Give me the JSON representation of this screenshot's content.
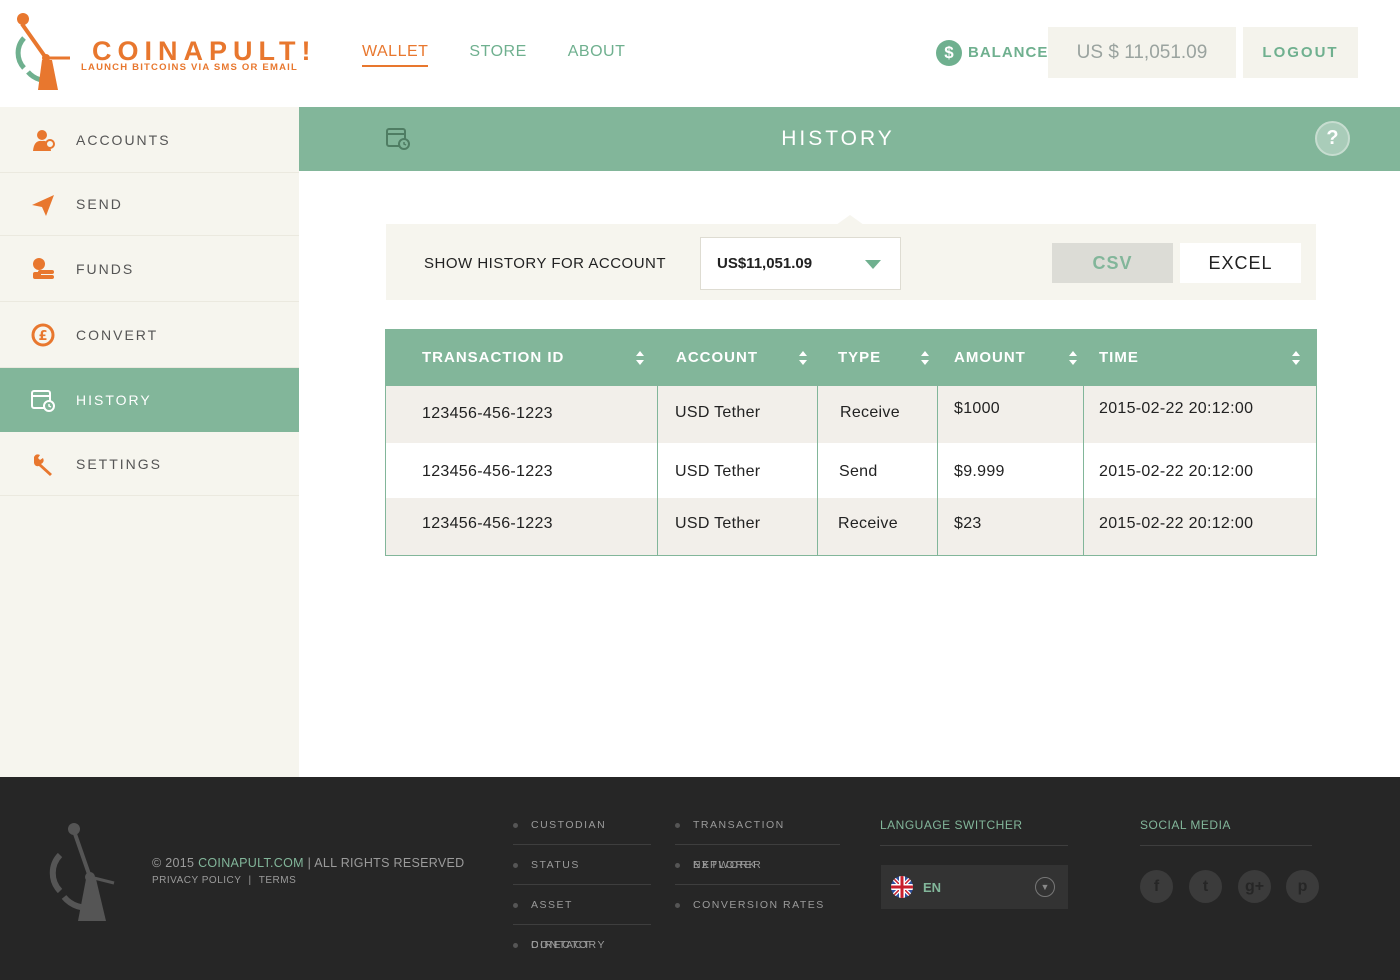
{
  "header": {
    "logo_title": "COINAPULT!",
    "logo_tagline": "LAUNCH BITCOINS VIA SMS OR EMAIL",
    "nav": [
      {
        "label": "WALLET",
        "active": true
      },
      {
        "label": "STORE"
      },
      {
        "label": "ABOUT"
      }
    ],
    "balance_icon": "$",
    "balance_label": "BALANCE",
    "balance_value": "US $ 11,051.09",
    "logout_label": "LOGOUT"
  },
  "sidebar": {
    "items": [
      {
        "label": "ACCOUNTS",
        "icon": "accounts-icon"
      },
      {
        "label": "SEND",
        "icon": "paper-plane-icon"
      },
      {
        "label": "FUNDS",
        "icon": "coins-icon"
      },
      {
        "label": "CONVERT",
        "icon": "currency-convert-icon"
      },
      {
        "label": "HISTORY",
        "icon": "calendar-clock-icon",
        "active": true
      },
      {
        "label": "SETTINGS",
        "icon": "wrench-icon"
      }
    ]
  },
  "main": {
    "title": "HISTORY",
    "help_label": "?",
    "filter": {
      "label": "SHOW HISTORY FOR ACCOUNT",
      "selected_account": "US$11,051.09",
      "csv_label": "CSV",
      "excel_label": "EXCEL"
    },
    "table": {
      "columns": [
        "TRANSACTION ID",
        "ACCOUNT",
        "TYPE",
        "AMOUNT",
        "TIME"
      ],
      "rows": [
        {
          "id": "123456-456-1223",
          "account": "USD Tether",
          "type": "Receive",
          "amount": "$1000",
          "time": "2015-02-22 20:12:00"
        },
        {
          "id": "123456-456-1223",
          "account": "USD Tether",
          "type": "Send",
          "amount": "$9.999",
          "time": "2015-02-22 20:12:00"
        },
        {
          "id": "123456-456-1223",
          "account": "USD Tether",
          "type": "Receive",
          "amount": "$23",
          "time": "2015-02-22 20:12:00"
        }
      ]
    }
  },
  "footer": {
    "copyright_prefix": "© 2015",
    "brand": "COINAPULT.COM",
    "copyright_suffix": "| ALL RIGHTS RESERVED",
    "privacy": "PRIVACY POLICY",
    "separator": "|",
    "terms": "TERMS",
    "links_col1": [
      "CUSTODIAN",
      "STATUS",
      "ASSET DIRECTORY",
      "CONTACT"
    ],
    "links_col2": [
      "TRANSACTION NETWORK",
      "EXPLORER",
      "CONVERSION RATES"
    ],
    "language_heading": "LANGUAGE SWITCHER",
    "language_value": "EN",
    "social_heading": "SOCIAL MEDIA",
    "social": [
      {
        "icon": "facebook-icon",
        "glyph": "f"
      },
      {
        "icon": "twitter-icon",
        "glyph": "t"
      },
      {
        "icon": "google-plus-icon",
        "glyph": "g+"
      },
      {
        "icon": "pinterest-icon",
        "glyph": "p"
      }
    ]
  },
  "colors": {
    "accent_orange": "#e8772e",
    "accent_green": "#82b69a",
    "panel_bg": "#f6f5ee",
    "footer_bg": "#262626"
  }
}
